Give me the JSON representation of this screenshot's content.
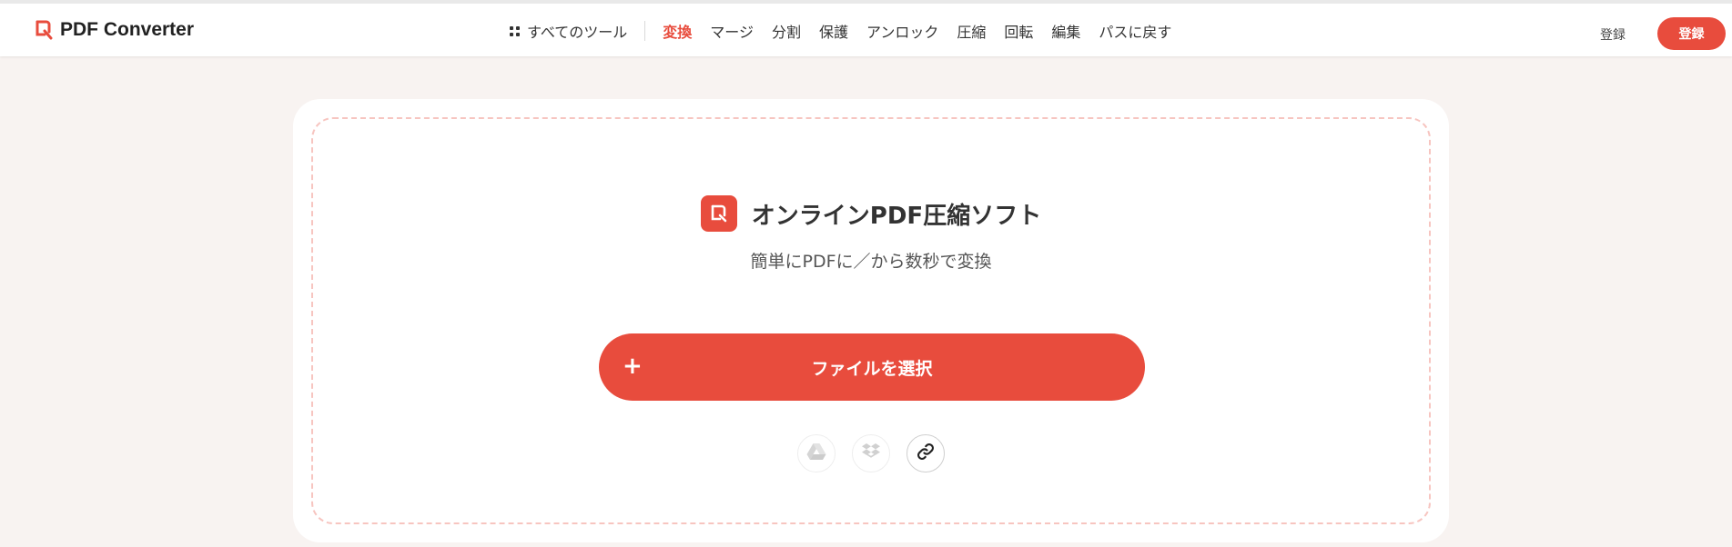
{
  "header": {
    "logo_text": "PDF Converter",
    "all_tools_label": "すべてのツール",
    "nav_items": [
      {
        "label": "変換",
        "active": true
      },
      {
        "label": "マージ",
        "active": false
      },
      {
        "label": "分割",
        "active": false
      },
      {
        "label": "保護",
        "active": false
      },
      {
        "label": "アンロック",
        "active": false
      },
      {
        "label": "圧縮",
        "active": false
      },
      {
        "label": "回転",
        "active": false
      },
      {
        "label": "編集",
        "active": false
      },
      {
        "label": "パスに戻す",
        "active": false
      }
    ],
    "login_label": "登録",
    "signup_label": "登録"
  },
  "main": {
    "title": "オンラインPDF圧縮ソフト",
    "subtitle": "簡単にPDFに／から数秒で変換",
    "select_button_label": "ファイルを選択",
    "select_button_icon": "plus-icon",
    "sources": [
      {
        "name": "google-drive-icon"
      },
      {
        "name": "dropbox-icon"
      },
      {
        "name": "link-icon"
      }
    ]
  },
  "colors": {
    "accent": "#e84c3d",
    "background": "#f8f3f1",
    "dropzone_border": "#f7c5c0"
  }
}
